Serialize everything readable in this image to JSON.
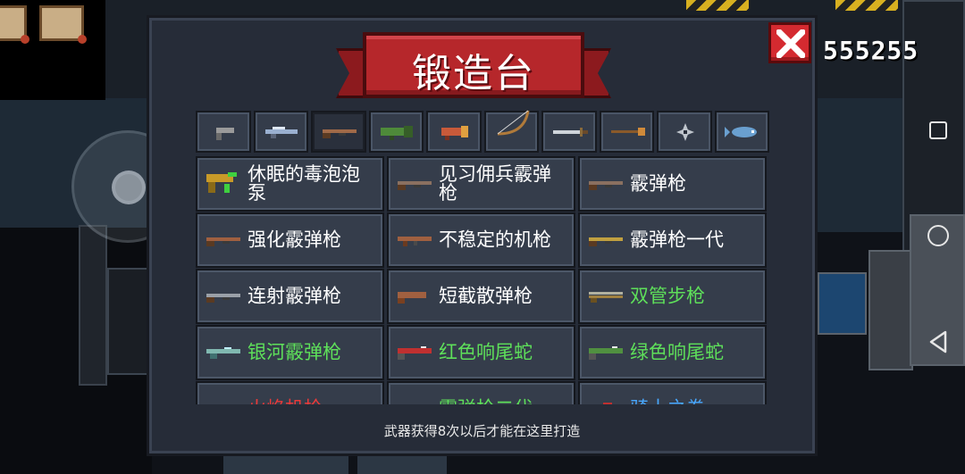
{
  "forge": {
    "title": "锻造台",
    "footer_note": "武器获得8次以后才能在这里打造",
    "gems": "555255",
    "close_label": "关闭"
  },
  "tabs": [
    {
      "icon": "pistol-icon",
      "color": "#9a9a9a"
    },
    {
      "icon": "laser-rifle-icon",
      "color": "#9ab0d0"
    },
    {
      "icon": "shotgun-icon",
      "color": "#a06a48"
    },
    {
      "icon": "rocket-launcher-icon",
      "color": "#4e8a3a"
    },
    {
      "icon": "launcher-icon",
      "color": "#c85a3a"
    },
    {
      "icon": "bow-icon",
      "color": "#b07a3a"
    },
    {
      "icon": "sword-icon",
      "color": "#cfd4da"
    },
    {
      "icon": "staff-icon",
      "color": "#d08a3a"
    },
    {
      "icon": "throwing-star-icon",
      "color": "#bfc5cc"
    },
    {
      "icon": "fish-icon",
      "color": "#6aa0d0"
    }
  ],
  "weapons": [
    {
      "name": "休眠的毒泡泡泵",
      "color": "white",
      "icon": "pump-gun-icon",
      "tint": "#c89a28"
    },
    {
      "name": "见习佣兵霰弹枪",
      "color": "white",
      "icon": "shotgun-icon",
      "tint": "#8a7060"
    },
    {
      "name": "霰弹枪",
      "color": "white",
      "icon": "shotgun-icon",
      "tint": "#8a7060"
    },
    {
      "name": "强化霰弹枪",
      "color": "white",
      "icon": "shotgun-icon",
      "tint": "#a06040"
    },
    {
      "name": "不稳定的机枪",
      "color": "white",
      "icon": "machine-gun-icon",
      "tint": "#a06040"
    },
    {
      "name": "霰弹枪一代",
      "color": "white",
      "icon": "shotgun-icon",
      "tint": "#c0a040"
    },
    {
      "name": "连射霰弹枪",
      "color": "white",
      "icon": "shotgun-icon",
      "tint": "#9aa0a8"
    },
    {
      "name": "短截散弹枪",
      "color": "white",
      "icon": "sawed-off-icon",
      "tint": "#a06040"
    },
    {
      "name": "双管步枪",
      "color": "green",
      "icon": "double-barrel-icon",
      "tint": "#a08040"
    },
    {
      "name": "银河霰弹枪",
      "color": "green",
      "icon": "galaxy-shotgun-icon",
      "tint": "#80b8b0"
    },
    {
      "name": "红色响尾蛇",
      "color": "green",
      "icon": "red-rattlesnake-icon",
      "tint": "#c03030"
    },
    {
      "name": "绿色响尾蛇",
      "color": "green",
      "icon": "green-rattlesnake-icon",
      "tint": "#509040"
    },
    {
      "name": "火焰机枪",
      "color": "red",
      "icon": "flame-gun-icon",
      "tint": "#c04030"
    },
    {
      "name": "霰弹枪二代",
      "color": "green",
      "icon": "shotgun-icon",
      "tint": "#8a7060"
    },
    {
      "name": "骑士之拳",
      "color": "blue",
      "icon": "knight-fist-icon",
      "tint": "#c0c0c0"
    }
  ],
  "colors": {
    "panel_bg": "#262c38",
    "banner_red": "#b6272b",
    "close_red": "#d42a30",
    "text_white": "#ffffff",
    "text_green": "#5ee05a",
    "text_blue": "#48a8ff",
    "text_red": "#e83a3a"
  }
}
